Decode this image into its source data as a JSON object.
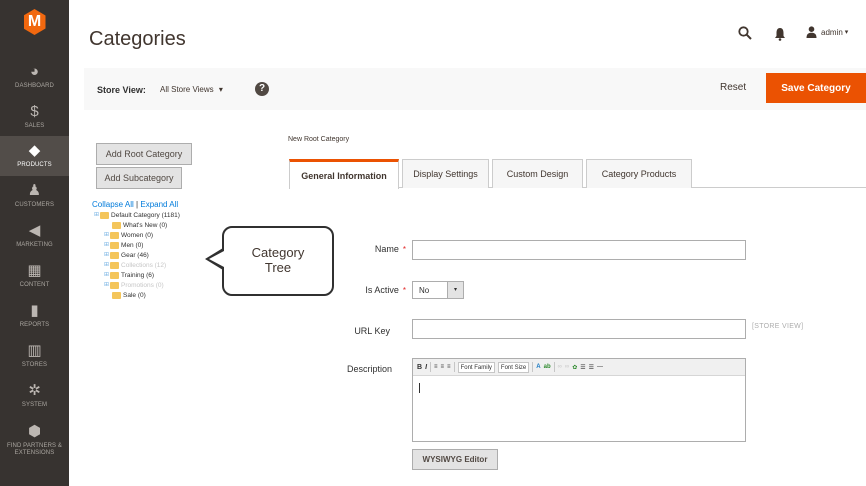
{
  "sidebar": {
    "logo_glyph": "M",
    "items": [
      {
        "label": "DASHBOARD",
        "icon": "dashboard-icon",
        "glyph": "◕"
      },
      {
        "label": "SALES",
        "icon": "dollar-icon",
        "glyph": "$"
      },
      {
        "label": "PRODUCTS",
        "icon": "cube-icon",
        "glyph": "◆"
      },
      {
        "label": "CUSTOMERS",
        "icon": "person-icon",
        "glyph": "♟"
      },
      {
        "label": "MARKETING",
        "icon": "megaphone-icon",
        "glyph": "◀"
      },
      {
        "label": "CONTENT",
        "icon": "content-icon",
        "glyph": "▦"
      },
      {
        "label": "REPORTS",
        "icon": "bar-chart-icon",
        "glyph": "▮"
      },
      {
        "label": "STORES",
        "icon": "store-icon",
        "glyph": "▥"
      },
      {
        "label": "SYSTEM",
        "icon": "gear-icon",
        "glyph": "✲"
      },
      {
        "label": "FIND PARTNERS & EXTENSIONS",
        "icon": "partners-icon",
        "glyph": "⬢"
      }
    ],
    "active_index": 2
  },
  "header": {
    "title": "Categories",
    "user_label": "admin",
    "caret": "▾"
  },
  "action_bar": {
    "store_view_label": "Store View:",
    "store_view_value": "All Store Views",
    "store_view_caret": "▾",
    "help_glyph": "?",
    "reset_label": "Reset",
    "save_label": "Save Category"
  },
  "tree": {
    "add_root_label": "Add Root Category",
    "add_sub_label": "Add Subcategory",
    "collapse_all": "Collapse All",
    "separator": "|",
    "expand_all": "Expand All",
    "toggle_glyph": "⊞",
    "nodes": [
      {
        "label": "Default Category (1181)",
        "faded": false
      },
      {
        "label": "What's New (0)",
        "faded": false
      },
      {
        "label": "Women (0)",
        "faded": false
      },
      {
        "label": "Men (0)",
        "faded": false
      },
      {
        "label": "Gear (46)",
        "faded": false
      },
      {
        "label": "Collections (12)",
        "faded": true
      },
      {
        "label": "Training (6)",
        "faded": false
      },
      {
        "label": "Promotions (0)",
        "faded": true
      },
      {
        "label": "Sale (0)",
        "faded": false
      }
    ]
  },
  "callout": {
    "line1": "Category",
    "line2": "Tree"
  },
  "form": {
    "section_title": "New Root Category",
    "tabs": [
      {
        "label": "General Information",
        "active": true
      },
      {
        "label": "Display Settings",
        "active": false
      },
      {
        "label": "Custom Design",
        "active": false
      },
      {
        "label": "Category Products",
        "active": false
      }
    ],
    "name_label": "Name",
    "required_mark": "*",
    "name_value": "",
    "is_active_label": "Is Active",
    "is_active_value": "No",
    "select_arrow": "▾",
    "url_key_label": "URL Key",
    "url_key_value": "",
    "store_view_note": "[STORE VIEW]",
    "description_label": "Description",
    "editor": {
      "bold": "B",
      "italic": "I",
      "font_family": "Font Family",
      "font_size": "Font Size",
      "text_color": "A",
      "highlight": "ab"
    },
    "wysiwyg_label": "WYSIWYG Editor"
  },
  "colors": {
    "accent": "#eb5202",
    "sidebar_bg": "#373330",
    "link": "#007bdb"
  }
}
